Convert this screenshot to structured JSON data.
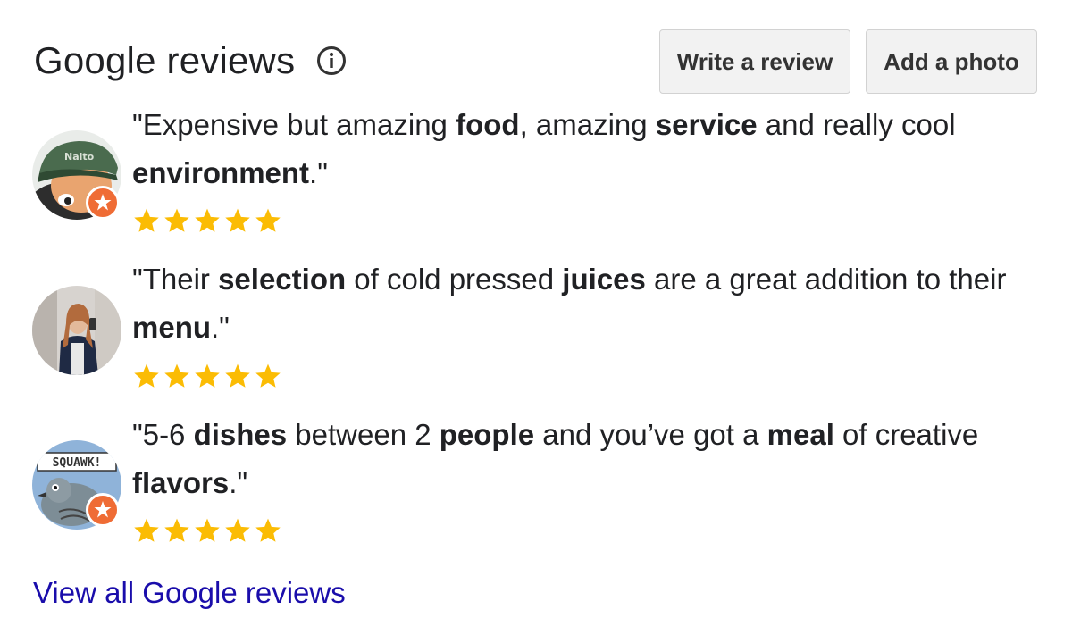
{
  "header": {
    "title": "Google reviews",
    "info_icon": "info-icon"
  },
  "buttons": {
    "write_review": "Write a review",
    "add_photo": "Add a photo"
  },
  "reviews": [
    {
      "segments": [
        {
          "text": "\"Expensive but amazing ",
          "bold": false
        },
        {
          "text": "food",
          "bold": true
        },
        {
          "text": ", amazing ",
          "bold": false
        },
        {
          "text": "service",
          "bold": true
        },
        {
          "text": " and really cool ",
          "bold": false
        },
        {
          "text": "environment",
          "bold": true
        },
        {
          "text": ".\"",
          "bold": false
        }
      ],
      "rating": 5,
      "avatar": "cartoon-avatar",
      "local_guide_badge": true
    },
    {
      "segments": [
        {
          "text": "\"Their ",
          "bold": false
        },
        {
          "text": "selection",
          "bold": true
        },
        {
          "text": " of cold pressed ",
          "bold": false
        },
        {
          "text": "juices",
          "bold": true
        },
        {
          "text": " are a great addition to their ",
          "bold": false
        },
        {
          "text": "menu",
          "bold": true
        },
        {
          "text": ".\"",
          "bold": false
        }
      ],
      "rating": 5,
      "avatar": "photo-avatar",
      "local_guide_badge": false
    },
    {
      "segments": [
        {
          "text": "\"5-6 ",
          "bold": false
        },
        {
          "text": "dishes",
          "bold": true
        },
        {
          "text": " between 2 ",
          "bold": false
        },
        {
          "text": "people",
          "bold": true
        },
        {
          "text": " and you’ve got a ",
          "bold": false
        },
        {
          "text": "meal",
          "bold": true
        },
        {
          "text": " of creative ",
          "bold": false
        },
        {
          "text": "flavors",
          "bold": true
        },
        {
          "text": ".\"",
          "bold": false
        }
      ],
      "rating": 5,
      "avatar": "bird-avatar",
      "avatar_text": "SQUAWK!",
      "local_guide_badge": true
    }
  ],
  "footer": {
    "view_all": "View all Google reviews"
  },
  "colors": {
    "star": "#fbbc04",
    "link": "#1a0dab",
    "badge": "#ef6c35"
  }
}
